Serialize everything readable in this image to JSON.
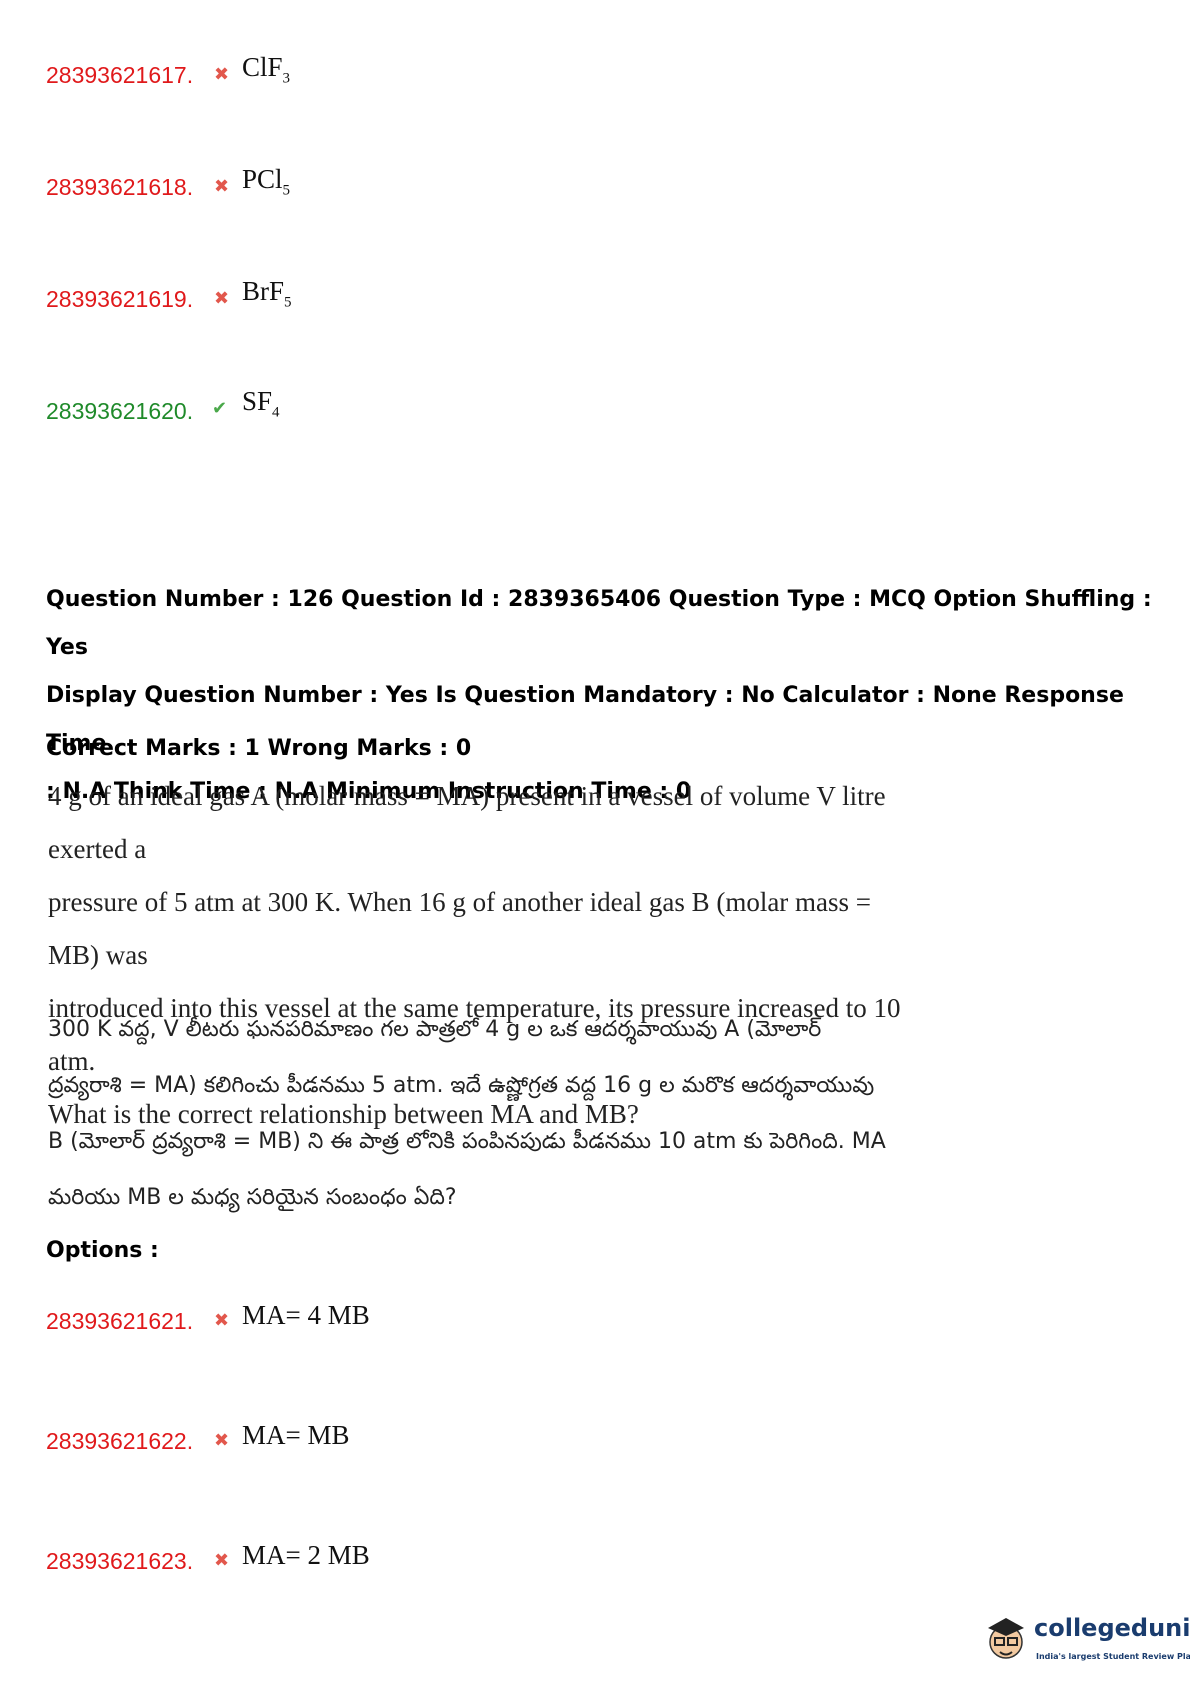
{
  "prev_options": [
    {
      "number": "28393621617.",
      "status": "wrong",
      "formula": "ClF",
      "sub": "3"
    },
    {
      "number": "28393621618.",
      "status": "wrong",
      "formula": "PCl",
      "sub": "5"
    },
    {
      "number": "28393621619.",
      "status": "wrong",
      "formula": "BrF",
      "sub": "5"
    },
    {
      "number": "28393621620.",
      "status": "right",
      "formula": "SF",
      "sub": "4"
    }
  ],
  "question": {
    "meta_line1": "Question Number : 126 Question Id : 2839365406 Question Type : MCQ Option Shuffling : Yes",
    "meta_line2": "Display Question Number : Yes Is Question Mandatory : No Calculator : None Response Time",
    "meta_line3": ": N.A Think Time : N.A Minimum Instruction Time : 0",
    "marks": "Correct Marks : 1 Wrong Marks : 0",
    "english": [
      "4 g of an ideal gas A (molar mass = MA) present in a vessel of volume V litre exerted a",
      "pressure of 5 atm at 300 K. When 16 g of another ideal gas B (molar mass = MB) was",
      "introduced into this vessel at the same temperature, its pressure increased to 10 atm.",
      "What is the correct relationship between MA and MB?"
    ],
    "telugu": [
      "300 K వద్ద, V లీటరు ఘనపరిమాణం గల పాత్రలో 4 g ల ఒక ఆదర్శవాయువు A (మోలార్",
      "ద్రవ్యరాశి = MA) కలిగించు పీడనము 5 atm. ఇదే ఉష్ణోగ్రత వద్ద 16 g ల మరొక ఆదర్శవాయువు",
      "B (మోలార్ ద్రవ్యరాశి = MB) ని ఈ పాత్ర లోనికి పంపినపుడు పీడనము 10 atm కు పెరిగింది. MA",
      "మరియు MB ల మధ్య సరియైన సంబంధం ఏది?"
    ],
    "options_label": "Options :"
  },
  "options": [
    {
      "number": "28393621621.",
      "status": "wrong",
      "text": "MA= 4 MB"
    },
    {
      "number": "28393621622.",
      "status": "wrong",
      "text": "MA= MB"
    },
    {
      "number": "28393621623.",
      "status": "wrong",
      "text": "MA= 2 MB"
    }
  ],
  "icons": {
    "wrong": "cross-icon",
    "right": "check-icon"
  },
  "colors": {
    "wrong_number": "#e0191b",
    "right_number": "#1f8a2a",
    "brand": "#1a3c6e"
  },
  "logo": {
    "name": "collegedunia",
    "tagline": "India's largest Student Review Platform"
  }
}
